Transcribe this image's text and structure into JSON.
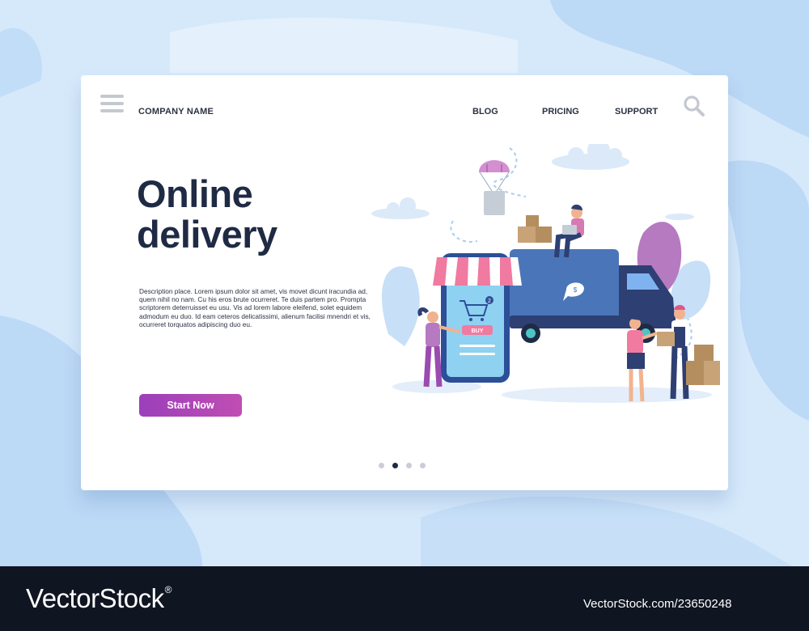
{
  "header": {
    "company_name": "COMPANY NAME",
    "nav": [
      {
        "label": "BLOG"
      },
      {
        "label": "PRICING"
      },
      {
        "label": "SUPPORT"
      }
    ]
  },
  "hero": {
    "title_line1": "Online",
    "title_line2": "delivery",
    "description": "Description place.  Lorem ipsum dolor sit amet, vis movet dicunt iracundia ad, quem nihil no nam. Cu his eros brute ocurreret. Te duis partem pro. Prompta scriptorem deterruisset eu usu. Vis ad lorem labore eleifend, solet equidem admodum eu duo. Id eam ceteros delicatissimi, alienum facilisi mnendri et vis, ocurreret torquatos adipiscing duo eu.",
    "cta_label": "Start Now"
  },
  "illustration": {
    "cart_badge": "2",
    "buy_label": "BUY",
    "bubble_symbol": "$"
  },
  "pagination": {
    "total": 4,
    "active_index": 1
  },
  "watermark": {
    "brand": "VectorStock",
    "registered": "®",
    "image_code": "VectorStock.com/23650248"
  },
  "colors": {
    "background": "#d6e9fb",
    "card": "#ffffff",
    "headline": "#1f2a44",
    "cta_start": "#9b3fba",
    "cta_end": "#c04eb3",
    "truck": "#4a76b9",
    "footer": "#0f1521"
  },
  "icons": [
    "hamburger-menu-icon",
    "search-icon",
    "cart-icon"
  ]
}
